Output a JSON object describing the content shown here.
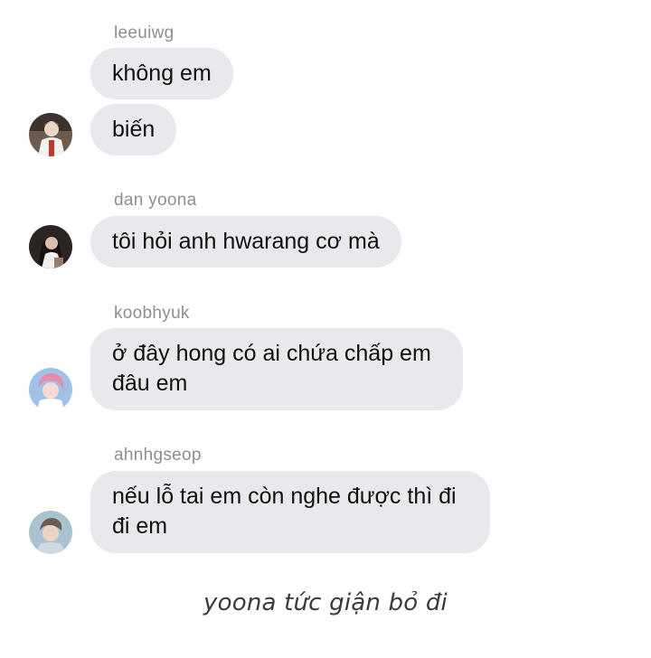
{
  "messages": [
    {
      "sender": "leeuiwg",
      "texts": [
        "không em",
        "biến"
      ],
      "avatar_icon": "user-photo-icon"
    },
    {
      "sender": "dan yoona",
      "texts": [
        "tôi hỏi anh hwarang cơ mà"
      ],
      "avatar_icon": "user-photo-icon"
    },
    {
      "sender": "koobhyuk",
      "texts": [
        "ở đây hong có ai chứa chấp em",
        "đâu em"
      ],
      "avatar_icon": "user-photo-icon"
    },
    {
      "sender": "ahnhgseop",
      "texts": [
        "nếu lỗ tai em còn nghe được thì đi",
        "đi em"
      ],
      "avatar_icon": "user-photo-icon"
    }
  ],
  "caption": "yoona tức giận bỏ đi",
  "colors": {
    "bubble": "#e8e8ed",
    "sender": "#8e8e93",
    "text": "#111111",
    "background": "#ffffff"
  }
}
